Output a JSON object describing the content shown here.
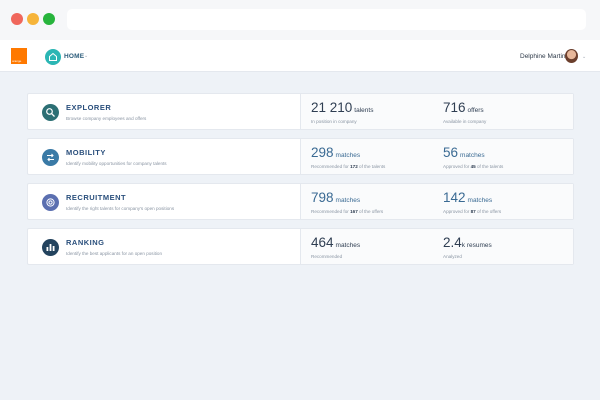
{
  "header": {
    "logo_text": "orange",
    "home_label": "HOME",
    "user_name": "Delphine Martin",
    "icons": {
      "home": "home-icon",
      "caret": "chevron-down-icon"
    }
  },
  "cards": [
    {
      "title": "EXPLORER",
      "subtitle": "Browse company employees and offers",
      "icon": "search-icon",
      "icon_color": "#2c6f74",
      "stat1": {
        "value": "21 210",
        "unit": "talents",
        "desc": "In position in company"
      },
      "stat2": {
        "value": "716",
        "unit": "offers",
        "desc": "Available in company"
      }
    },
    {
      "title": "MOBILITY",
      "subtitle": "Identify mobility opportunities for company talents",
      "icon": "mobility-arrows-icon",
      "icon_color": "#3a7aa6",
      "stat1": {
        "value": "298",
        "unit": "matches",
        "desc_pre": "Recommended for",
        "desc_num": "172",
        "desc_post": "of the talents"
      },
      "stat2": {
        "value": "56",
        "unit": "matches",
        "desc_pre": "Approved for",
        "desc_num": "45",
        "desc_post": "of the talents"
      }
    },
    {
      "title": "RECRUITMENT",
      "subtitle": "Identify the right talents for company's open positions",
      "icon": "target-icon",
      "icon_color": "#5b6fb0",
      "stat1": {
        "value": "798",
        "unit": "matches",
        "desc_pre": "Recommended for",
        "desc_num": "167",
        "desc_post": "of the offers"
      },
      "stat2": {
        "value": "142",
        "unit": "matches",
        "desc_pre": "Approved for",
        "desc_num": "87",
        "desc_post": "of the offers"
      }
    },
    {
      "title": "RANKING",
      "subtitle": "Identify the best applicants for an open position",
      "icon": "ranking-chart-icon",
      "icon_color": "#23435e",
      "stat1": {
        "value": "464",
        "unit": "matches",
        "desc": "Recommended"
      },
      "stat2": {
        "value": "2.4",
        "unit": "k resumes",
        "desc": "Analyzed"
      }
    }
  ]
}
